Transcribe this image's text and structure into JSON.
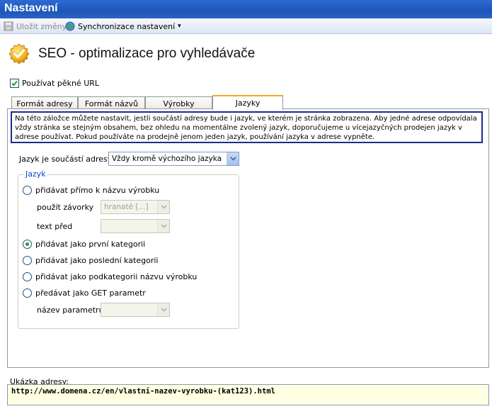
{
  "window": {
    "title": "Nastavení"
  },
  "toolbar": {
    "save_label": "Uložit změny",
    "sync_label": "Synchronizace nastavení",
    "sync_arrow": "▾"
  },
  "header": {
    "title": "SEO - optimalizace pro vyhledávače"
  },
  "pretty_url": {
    "label": "Používat pěkné URL",
    "checked": true
  },
  "tabs": [
    {
      "label": "Formát adresy"
    },
    {
      "label": "Formát názvů"
    },
    {
      "label": "Výrobky"
    },
    {
      "label": "Jazyky",
      "active": true
    }
  ],
  "info_text": "Na této záložce můžete nastavit, jestli součástí adresy bude i jazyk, ve kterém je stránka zobrazena. Aby jedné adrese odpovídala vždy stránka se stejným obsahem, bez ohledu na momentálne zvolený jazyk, doporučujeme u vícejazyčných prodejen jazyk v adrese používat. Pokud používáte na prodejně jenom jeden jazyk, používání jazyka v adrese vypněte.",
  "language_in_url": {
    "label": "Jazyk je součástí adresy",
    "value": "Vždy kromě výchozího jazyka"
  },
  "group": {
    "title": "Jazyk",
    "options": [
      {
        "label": "přidávat přímo k názvu výrobku",
        "selected": false
      },
      {
        "label": "přidávat jako první kategorii",
        "selected": true
      },
      {
        "label": "přidávat jako poslední kategorii",
        "selected": false
      },
      {
        "label": "přidávat jako podkategorii názvu výrobku",
        "selected": false
      },
      {
        "label": "předávat jako GET parametr",
        "selected": false
      }
    ],
    "brackets_label": "použít závorky",
    "brackets_value": "hranaté [...]",
    "text_before_label": "text před",
    "text_before_value": "",
    "param_name_label": "název parametru",
    "param_name_value": ""
  },
  "preview": {
    "label": "Ukázka adresy:",
    "url": "http://www.domena.cz/en/vlastni-nazev-vyrobku-(kat123).html"
  },
  "colors": {
    "titlebar": "#1d55b8",
    "info_border": "#1d2b8a",
    "preview_bg": "#ffffe1",
    "active_tab_accent": "#f5a623"
  }
}
